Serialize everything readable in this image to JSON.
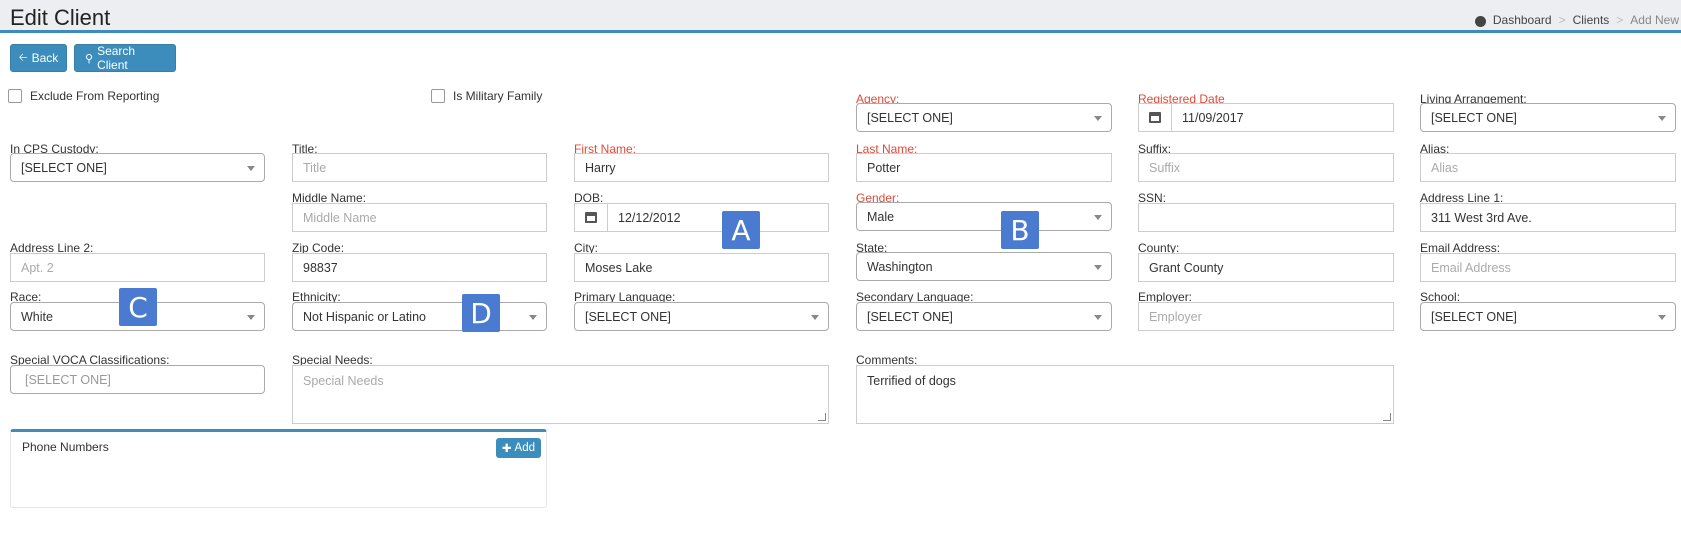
{
  "header": {
    "title": "Edit Client",
    "breadcrumb": {
      "dashboard": "Dashboard",
      "clients": "Clients",
      "current": "Add New"
    }
  },
  "toolbar": {
    "back_label": "Back",
    "search_label": "Search Client"
  },
  "checkboxes": {
    "exclude": "Exclude From Reporting",
    "military": "Is Military Family"
  },
  "labels": {
    "agency": "Agency:",
    "registered_date": "Registered Date",
    "living_arrangement": "Living Arrangement:",
    "cps_custody": "In CPS Custody:",
    "title": "Title:",
    "first_name": "First Name:",
    "last_name": "Last Name:",
    "suffix": "Suffix:",
    "alias": "Alias:",
    "middle_name": "Middle Name:",
    "dob": "DOB:",
    "gender": "Gender:",
    "ssn": "SSN:",
    "address1": "Address Line 1:",
    "address2": "Address Line 2:",
    "zip": "Zip Code:",
    "city": "City:",
    "state": "State:",
    "county": "County:",
    "email": "Email Address:",
    "race": "Race:",
    "ethnicity": "Ethnicity:",
    "primary_language": "Primary Language:",
    "secondary_language": "Secondary Language:",
    "employer": "Employer:",
    "school": "School:",
    "voca": "Special VOCA Classifications:",
    "special_needs": "Special Needs:",
    "comments": "Comments:"
  },
  "values": {
    "agency": "[SELECT ONE]",
    "registered_date": "11/09/2017",
    "living_arrangement": "[SELECT ONE]",
    "cps_custody": "[SELECT ONE]",
    "first_name": "Harry",
    "last_name": "Potter",
    "dob": "12/12/2012",
    "gender": "Male",
    "address1": "311 West 3rd Ave.",
    "zip": "98837",
    "city": "Moses Lake",
    "state": "Washington",
    "county": "Grant County",
    "race": "White",
    "ethnicity": "Not Hispanic or Latino",
    "primary_language": "[SELECT ONE]",
    "secondary_language": "[SELECT ONE]",
    "school": "[SELECT ONE]",
    "voca": "[SELECT ONE]",
    "comments": "Terrified of dogs"
  },
  "placeholders": {
    "title": "Title",
    "suffix": "Suffix",
    "alias": "Alias",
    "middle_name": "Middle Name",
    "address2": "Apt. 2",
    "email": "Email Address",
    "employer": "Employer",
    "special_needs": "Special Needs"
  },
  "markers": {
    "a": "A",
    "b": "B",
    "c": "C",
    "d": "D"
  },
  "phone_panel": {
    "title": "Phone Numbers",
    "add_label": "Add"
  },
  "colors": {
    "accent": "#3c8dbc",
    "required": "#dd4b39",
    "marker": "#4a7bd0"
  }
}
